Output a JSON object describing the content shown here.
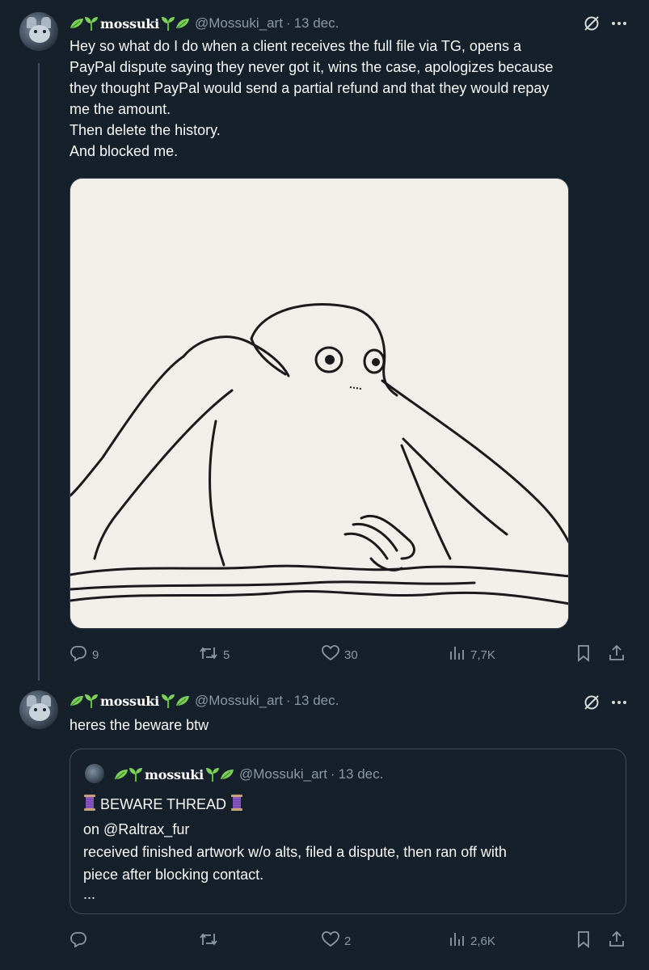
{
  "tweets": [
    {
      "display_name": "mossuki",
      "handle": "@Mossuki_art",
      "date": "13 dec.",
      "text_lines": [
        "Hey so what do I do when a client receives the full file via TG, opens a",
        "PayPal dispute saying they never got it, wins the case, apologizes because",
        "they thought PayPal would send a partial refund and that they would repay",
        "me the amount.",
        "Then delete the history.",
        "And blocked me."
      ],
      "replies": "9",
      "reposts": "5",
      "likes": "30",
      "views": "7,7K"
    },
    {
      "display_name": "mossuki",
      "handle": "@Mossuki_art",
      "date": "13 dec.",
      "text": "heres the beware btw",
      "replies": "",
      "reposts": "",
      "likes": "2",
      "views": "2,6K",
      "quote": {
        "display_name": "mossuki",
        "handle": "@Mossuki_art",
        "date": "13 dec.",
        "title": "BEWARE THREAD",
        "lines": [
          "on @Raltrax_fur",
          "received finished artwork w/o alts, filed a dispute, then ran off with",
          "piece after blocking contact.",
          "..."
        ]
      }
    }
  ],
  "separator_dot": "·",
  "colors": {
    "background": "#15202b",
    "text": "#f7f9f9",
    "muted": "#8b98a5",
    "border": "#3d4c5c",
    "leaf_green": "#7ccf5a",
    "spool": "#8e5ac8"
  },
  "icons": [
    "leaf-icon",
    "sprout-icon",
    "grok-icon",
    "more-icon",
    "reply-icon",
    "repost-icon",
    "like-icon",
    "views-icon",
    "bookmark-icon",
    "share-icon",
    "spool-icon"
  ]
}
